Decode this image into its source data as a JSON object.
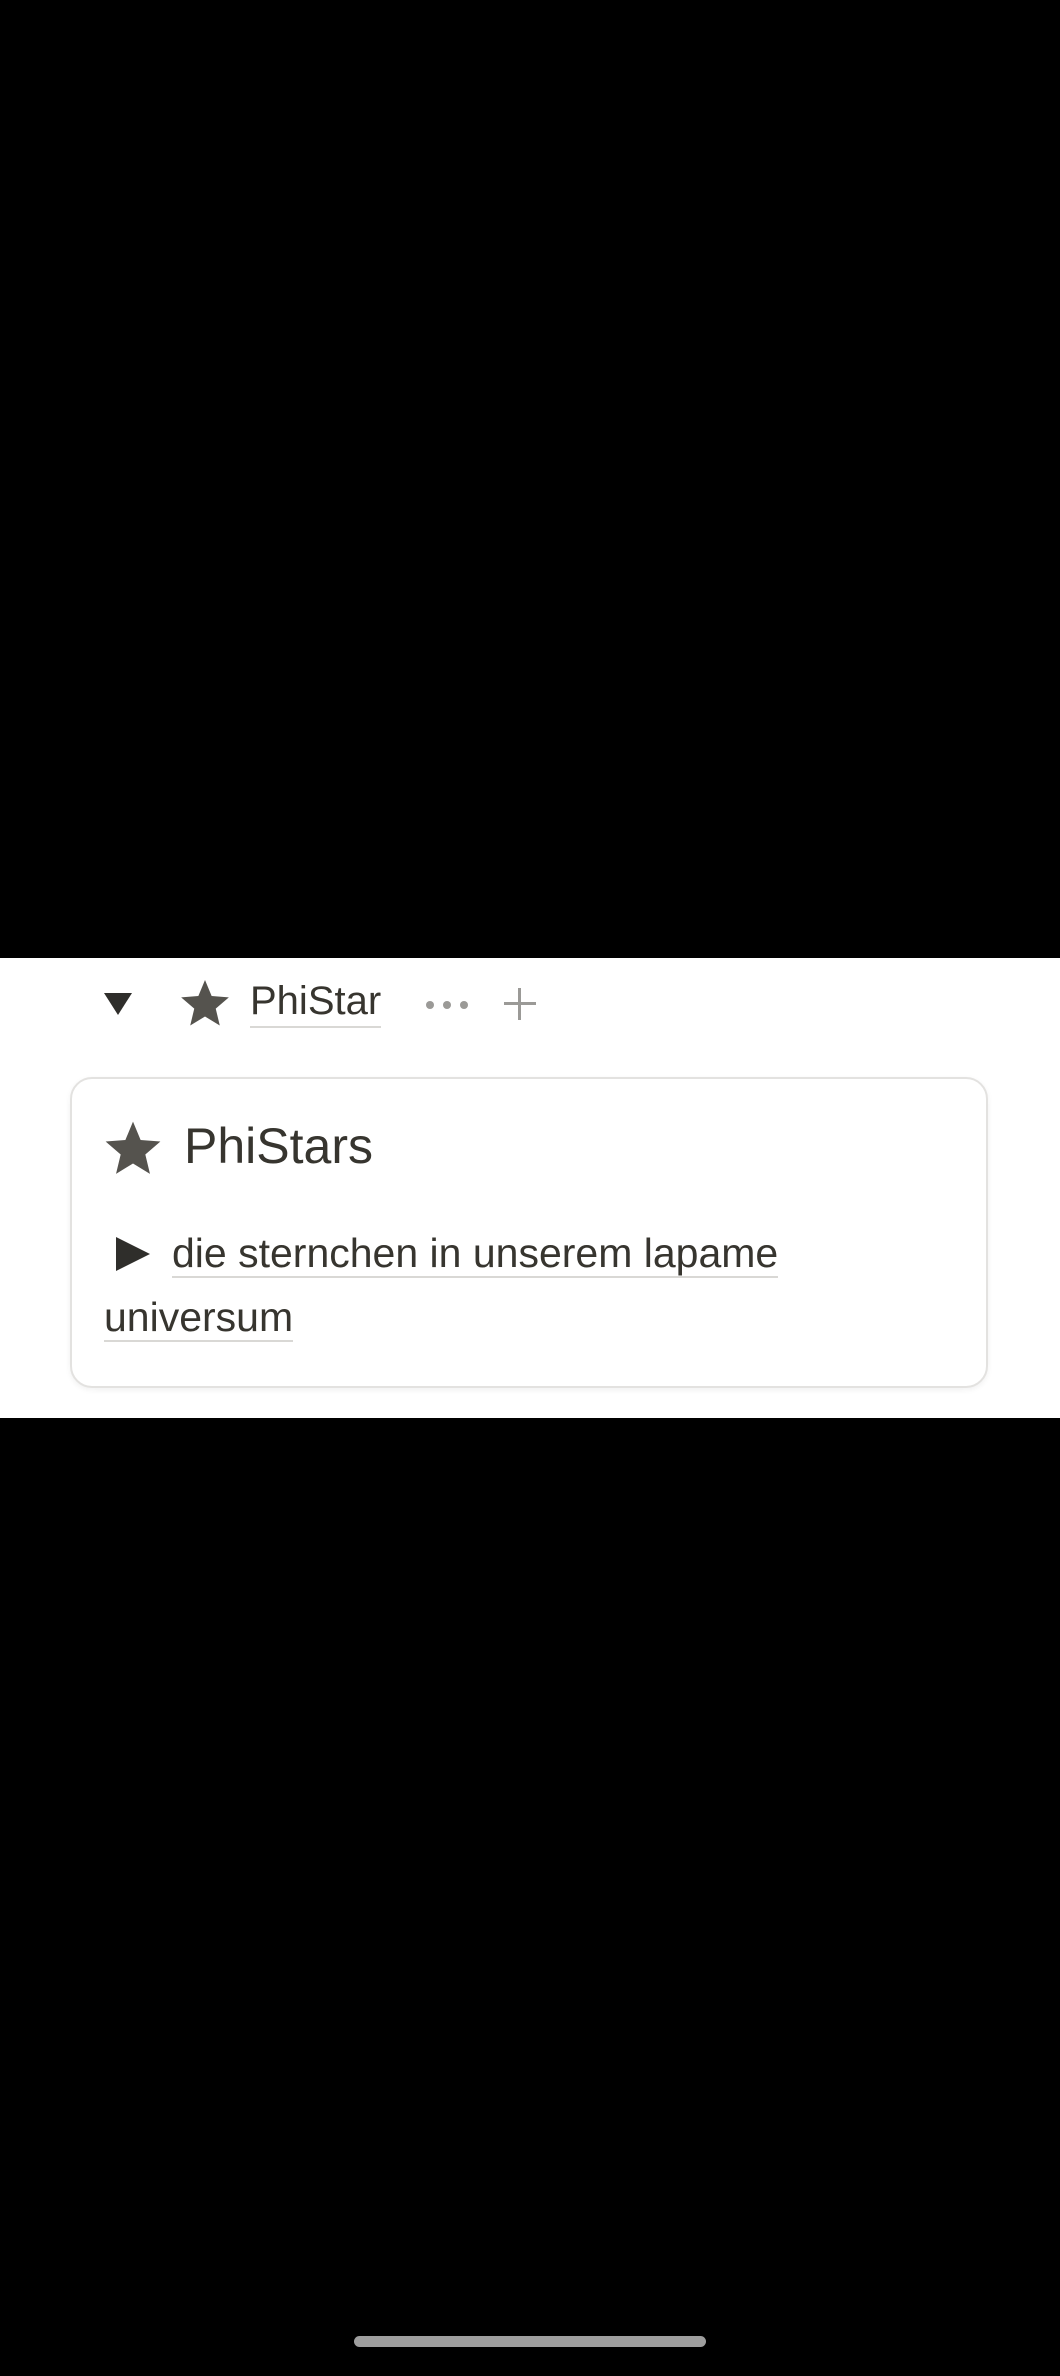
{
  "toggle_row": {
    "expanded_icon": "triangle-down-icon",
    "page_icon": "star-icon",
    "title": "PhiStar",
    "more_icon": "ellipsis-icon",
    "add_icon": "plus-icon"
  },
  "card": {
    "icon": "star-icon",
    "title": "PhiStars",
    "toggle_icon": "triangle-right-icon",
    "description": "die sternchen in unserem lapame universum"
  },
  "colors": {
    "text": "#37352f",
    "icon": "#55534e",
    "muted_icon": "#9b9a97",
    "card_border": "#e3e2e0",
    "background": "#000000",
    "panel": "#ffffff"
  }
}
